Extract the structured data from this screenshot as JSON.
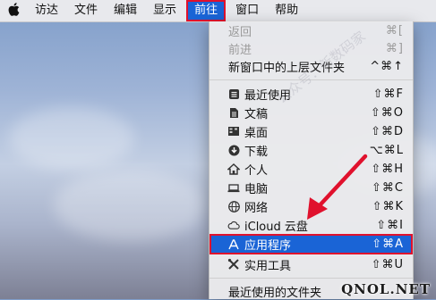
{
  "menubar": {
    "apple_icon": "",
    "items": [
      {
        "label": "访达"
      },
      {
        "label": "文件"
      },
      {
        "label": "编辑"
      },
      {
        "label": "显示"
      },
      {
        "label": "前往"
      },
      {
        "label": "窗口"
      },
      {
        "label": "帮助"
      }
    ]
  },
  "go_menu": {
    "back": {
      "label": "返回",
      "shortcut": "⌘["
    },
    "forward": {
      "label": "前进",
      "shortcut": "⌘]"
    },
    "enclosing": {
      "label": "新窗口中的上层文件夹",
      "shortcut": "^⌘↑"
    },
    "recents": {
      "label": "最近使用",
      "shortcut": "⇧⌘F",
      "icon": "recents-icon"
    },
    "documents": {
      "label": "文稿",
      "shortcut": "⇧⌘O",
      "icon": "documents-icon"
    },
    "desktop": {
      "label": "桌面",
      "shortcut": "⇧⌘D",
      "icon": "desktop-icon"
    },
    "downloads": {
      "label": "下载",
      "shortcut": "⌥⌘L",
      "icon": "download-icon"
    },
    "home": {
      "label": "个人",
      "shortcut": "⇧⌘H",
      "icon": "home-icon"
    },
    "computer": {
      "label": "电脑",
      "shortcut": "⇧⌘C",
      "icon": "computer-icon"
    },
    "network": {
      "label": "网络",
      "shortcut": "⇧⌘K",
      "icon": "network-icon"
    },
    "icloud": {
      "label": "iCloud 云盘",
      "shortcut": "⇧⌘I",
      "icon": "cloud-icon"
    },
    "applications": {
      "label": "应用程序",
      "shortcut": "⇧⌘A",
      "icon": "applications-icon"
    },
    "utilities": {
      "label": "实用工具",
      "shortcut": "⇧⌘U",
      "icon": "utilities-icon"
    },
    "recent_folders": {
      "label": "最近使用的文件夹"
    }
  },
  "watermark": "公众号：新数码家",
  "brand": "QNOL.NET",
  "colors": {
    "selection": "#1a64d6",
    "highlight_outline": "#e0112d",
    "arrow": "#e0112d"
  }
}
